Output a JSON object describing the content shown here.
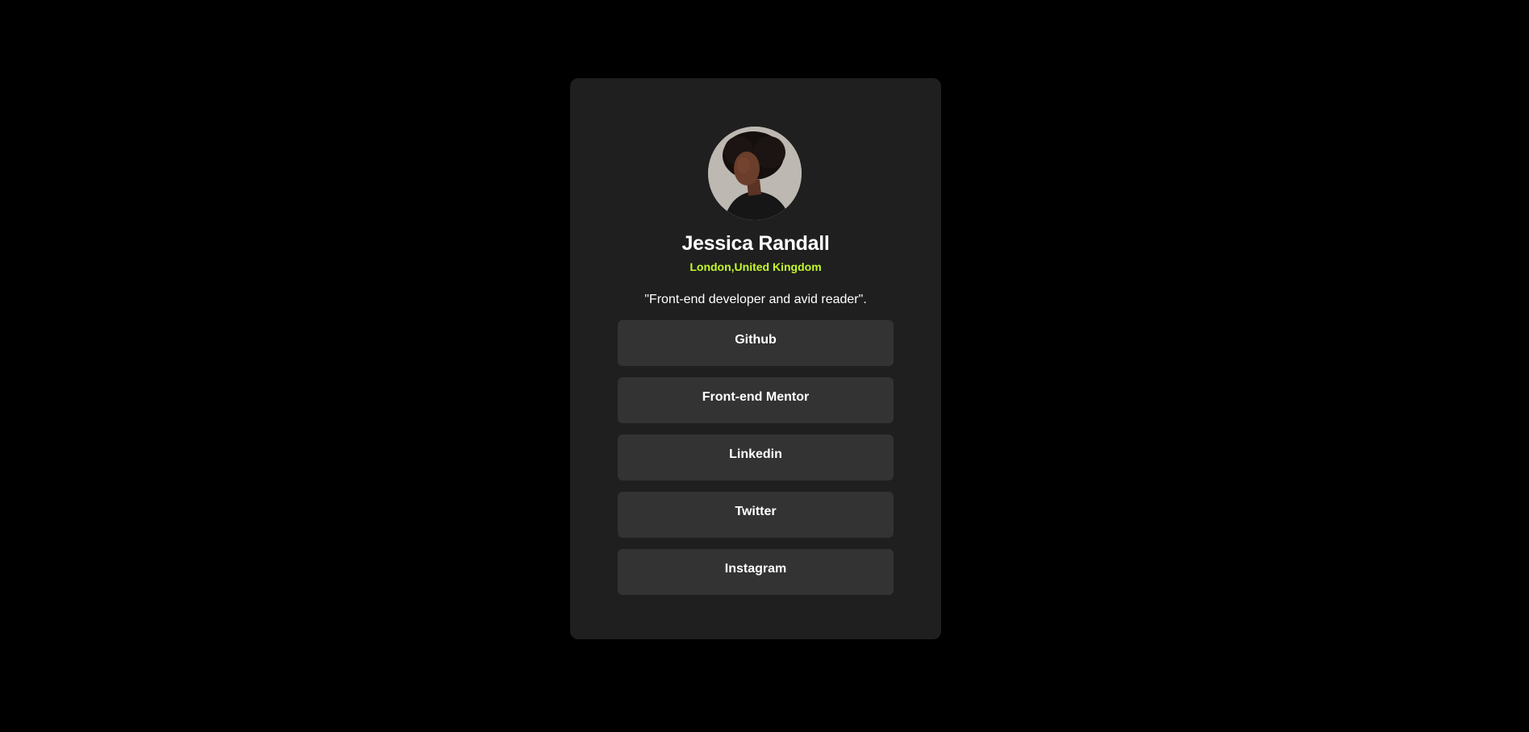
{
  "profile": {
    "name": "Jessica Randall",
    "location": "London,United Kingdom",
    "bio": "\"Front-end developer and avid reader\".",
    "avatar_icon": "avatar-photo"
  },
  "links": [
    {
      "label": "Github"
    },
    {
      "label": "Front-end Mentor"
    },
    {
      "label": "Linkedin"
    },
    {
      "label": "Twitter"
    },
    {
      "label": "Instagram"
    }
  ],
  "colors": {
    "page_background": "#000000",
    "card_background": "#1f1f1f",
    "button_background": "#333333",
    "accent": "#c4f82a",
    "text": "#ffffff"
  }
}
